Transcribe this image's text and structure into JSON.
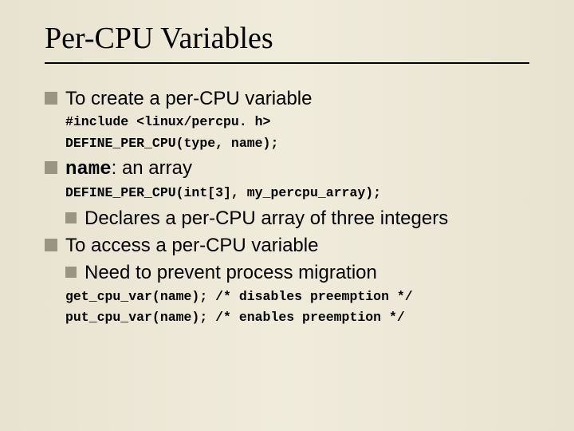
{
  "title": "Per-CPU Variables",
  "b1": "To create a per-CPU variable",
  "code1a": "#include <linux/percpu. h>",
  "code1b": "DEFINE_PER_CPU(type, name);",
  "b2_name": "name",
  "b2_rest": ": an array",
  "code2": "DEFINE_PER_CPU(int[3], my_percpu_array);",
  "b3": "Declares a per-CPU array of three integers",
  "b4": "To access a per-CPU variable",
  "b5": "Need to prevent process migration",
  "code3a": "get_cpu_var(name); /* disables preemption */",
  "code3b": "put_cpu_var(name); /* enables preemption */"
}
